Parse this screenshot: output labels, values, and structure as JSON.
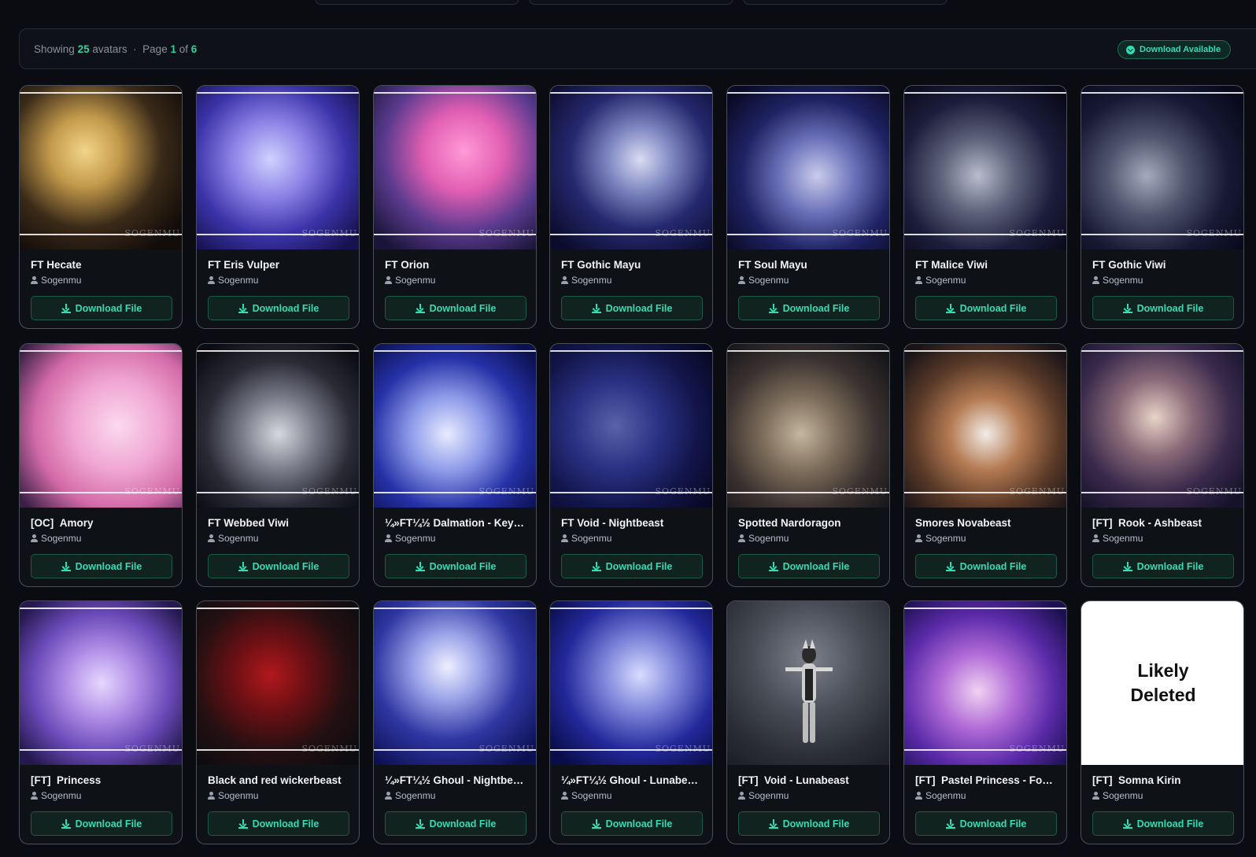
{
  "info_bar": {
    "showing_label": "Showing",
    "count": "25",
    "avatars_label": "avatars",
    "sep": "·",
    "page_label": "Page",
    "page_current": "1",
    "of_label": "of",
    "page_total": "6",
    "badge": "Download Available"
  },
  "download_label": "Download File",
  "deleted_label": "Likely\nDeleted",
  "colors": {
    "accent": "#35dcb4",
    "background": "#0a0c11",
    "card": "#0e1116"
  },
  "icons": [
    "user-icon",
    "download-icon",
    "check-circle-icon"
  ],
  "cards": [
    {
      "title": "FT Hecate",
      "author": "Sogenmu",
      "bg": "radial-gradient(circle at 40% 40%,#f1d48a 0%,#c49a4b 25%,#3a2a18 55%,#120c0a 85%)"
    },
    {
      "title": "FT Eris Vulper",
      "author": "Sogenmu",
      "bg": "radial-gradient(circle at 45% 45%,#cfd2ff 0%,#8c82e6 30%,#3a33a8 60%,#16124f 90%)"
    },
    {
      "title": "FT Orion",
      "author": "Sogenmu",
      "bg": "radial-gradient(circle at 55% 40%,#ff9ad6 0%,#e25fb3 30%,#5a3a8e 60%,#1a1538 90%)"
    },
    {
      "title": "FT Gothic Mayu",
      "author": "Sogenmu",
      "bg": "radial-gradient(circle at 55% 45%,#d8dcf2 0%,#8088c2 25%,#25286e 55%,#0b0c2c 90%)"
    },
    {
      "title": "FT Soul Mayu",
      "author": "Sogenmu",
      "bg": "radial-gradient(circle at 55% 55%,#c8ccec 0%,#6a70b8 30%,#1e2262 60%,#0a0b26 90%)"
    },
    {
      "title": "FT Malice Viwi",
      "author": "Sogenmu",
      "bg": "radial-gradient(circle at 45% 55%,#b8bccc 0%,#5c6078 30%,#1c1d3c 60%,#0a0a1a 90%)"
    },
    {
      "title": "FT Gothic Viwi",
      "author": "Sogenmu",
      "bg": "radial-gradient(circle at 40% 55%,#a6aabe 0%,#50546c 30%,#181a36 60%,#08091a 90%)"
    },
    {
      "title": "[OC]  Amory",
      "author": "Sogenmu",
      "bg": "radial-gradient(circle at 60% 50%,#fbd9ef 0%,#f0a6d2 35%,#d36aa8 65%,#3a2044 95%)"
    },
    {
      "title": "FT Webbed Viwi",
      "author": "Sogenmu",
      "bg": "radial-gradient(circle at 50% 55%,#d6d8de 0%,#7a7c8a 30%,#2a2b36 60%,#0c0c12 90%)"
    },
    {
      "title": "¼»FT¼½ Dalmation - Key…",
      "author": "Sogenmu",
      "bg": "radial-gradient(circle at 45% 55%,#e8ecff 0%,#8b99e8 30%,#2531a6 60%,#0c1150 90%)"
    },
    {
      "title": "FT Void - Nightbeast",
      "author": "Sogenmu",
      "bg": "radial-gradient(circle at 40% 50%,#5a62a8 0%,#2a3082 35%,#12154a 65%,#070822 95%)"
    },
    {
      "title": "Spotted Nardoragon",
      "author": "Sogenmu",
      "bg": "radial-gradient(circle at 45% 55%,#c4b6a0 0%,#7c6c5a 30%,#3a3230 60%,#16151a 90%)"
    },
    {
      "title": "Smores Novabeast",
      "author": "Sogenmu",
      "bg": "radial-gradient(circle at 50% 55%,#f2ece8 0%,#b47a52 30%,#5a3a28 60%,#1a1418 90%)"
    },
    {
      "title": "[FT]  Rook - Ashbeast",
      "author": "Sogenmu",
      "bg": "radial-gradient(circle at 45% 45%,#e8d4c8 0%,#8a6a78 30%,#3a2a4c 60%,#15122a 90%)"
    },
    {
      "title": "[FT]  Princess",
      "author": "Sogenmu",
      "bg": "radial-gradient(circle at 50% 50%,#e6d8ff 0%,#b08ee6 30%,#6a4ab8 60%,#24184e 90%)"
    },
    {
      "title": "Black and red wickerbeast",
      "author": "Sogenmu",
      "bg": "radial-gradient(circle at 45% 45%,#b0181c 0%,#6a1014 30%,#241012 60%,#0c0c10 90%)"
    },
    {
      "title": "¼»FT¼½ Ghoul - Nightbe…",
      "author": "Sogenmu",
      "bg": "radial-gradient(circle at 45% 40%,#eef0ff 0%,#9aa2e8 25%,#2e36a2 55%,#0c1050 90%)"
    },
    {
      "title": "¼»FT¼½ Ghoul - Lunabe…",
      "author": "Sogenmu",
      "bg": "radial-gradient(circle at 55% 45%,#d8dcff 0%,#7a82d8 30%,#22289a 60%,#0a0d48 90%)"
    },
    {
      "title": "[FT]  Void - Lunabeast",
      "author": "Sogenmu",
      "bg": "radial-gradient(circle at 50% 35%,#7c818c 0%,#4a4e58 40%,#2a2d34 75%,#1c1e24 100%)",
      "figure": true
    },
    {
      "title": "[FT]  Pastel Princess - Fo…",
      "author": "Sogenmu",
      "bg": "radial-gradient(circle at 45% 55%,#f0d2f2 0%,#b06ad6 30%,#5a2aa8 60%,#1c1050 90%)"
    },
    {
      "title": "[FT]  Somna Kirin",
      "author": "Sogenmu",
      "deleted": true
    }
  ]
}
